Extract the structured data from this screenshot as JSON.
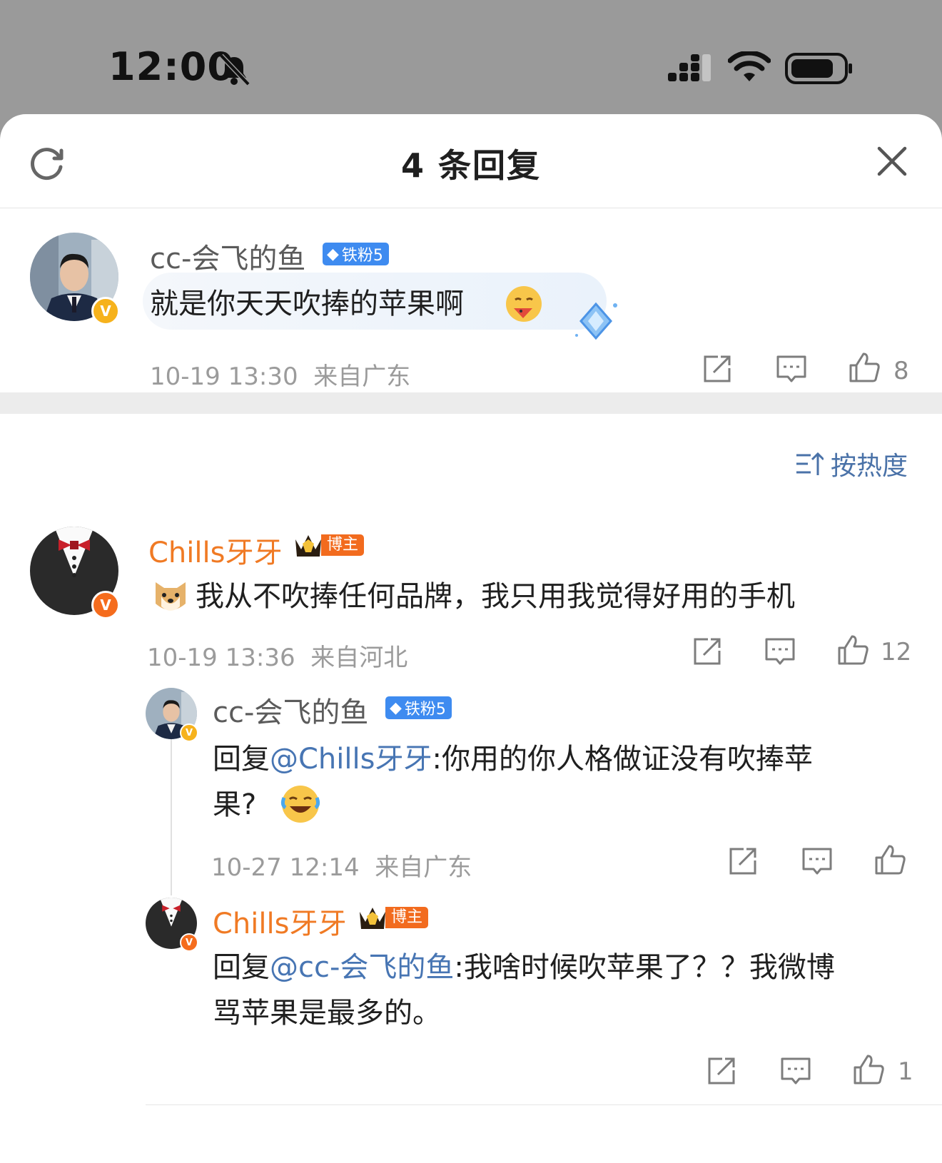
{
  "status_bar": {
    "time": "12:00"
  },
  "sheet": {
    "title": "4 条回复"
  },
  "sort": {
    "label": "按热度"
  },
  "comments": [
    {
      "username": "cc-会飞的鱼",
      "badge": "铁粉5",
      "text": "就是你天天吹捧的苹果啊",
      "time": "10-19 13:30",
      "location": "来自广东",
      "likes": "8"
    },
    {
      "username": "Chills牙牙",
      "badge": "博主",
      "text": "我从不吹捧任何品牌，我只用我觉得好用的手机",
      "time": "10-19 13:36",
      "location": "来自河北",
      "likes": "12"
    },
    {
      "username": "cc-会飞的鱼",
      "badge": "铁粉5",
      "reply_prefix": "回复",
      "mention": "@Chills牙牙",
      "text_line1": ":你用的你人格做证没有吹捧苹",
      "text_line2": "果?",
      "time": "10-27 12:14",
      "location": "来自广东",
      "likes": ""
    },
    {
      "username": "Chills牙牙",
      "badge": "博主",
      "reply_prefix": "回复",
      "mention": "@cc-会飞的鱼",
      "text_line1": ":我啥时候吹苹果了？？我微博",
      "text_line2": "骂苹果是最多的。",
      "likes": "1"
    }
  ],
  "colors": {
    "mention": "#4775b3",
    "blogger": "#f07a24",
    "fan_badge": "#3e8bf0"
  },
  "icons": [
    "bell-off-icon",
    "signal-icon",
    "wifi-icon",
    "battery-icon",
    "refresh-icon",
    "close-icon",
    "share-icon",
    "comment-icon",
    "like-icon",
    "sort-icon"
  ]
}
